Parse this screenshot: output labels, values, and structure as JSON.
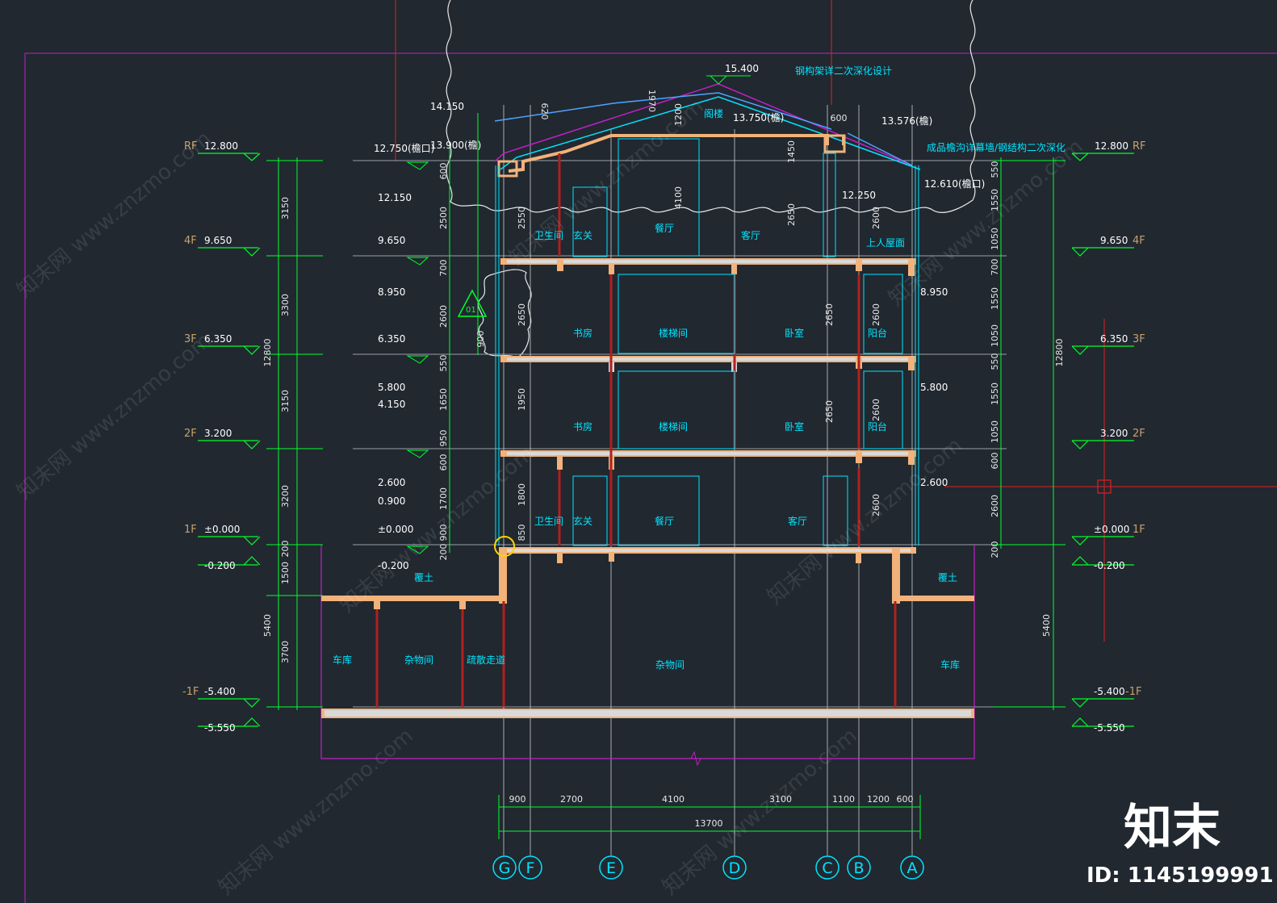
{
  "section": {
    "levels_left": {
      "rf": {
        "tag": "RF",
        "value": "12.800"
      },
      "f4": {
        "tag": "4F",
        "value": "9.650"
      },
      "f3": {
        "tag": "3F",
        "value": "6.350"
      },
      "f2": {
        "tag": "2F",
        "value": "3.200"
      },
      "f1": {
        "tag": "1F",
        "value": "±0.000"
      },
      "f1_sub": "-0.200",
      "b1": {
        "tag": "-1F",
        "value": "-5.400"
      },
      "b1_sub": "-5.550"
    },
    "levels_right": {
      "rf": {
        "tag": "RF",
        "value": "12.800"
      },
      "f4": {
        "tag": "4F",
        "value": "9.650"
      },
      "f3": {
        "tag": "3F",
        "value": "6.350"
      },
      "f2": {
        "tag": "2F",
        "value": "3.200"
      },
      "f1": {
        "tag": "1F",
        "value": "±0.000"
      },
      "f1_sub": "-0.200",
      "b1": {
        "tag": "-1F",
        "value": "-5.400"
      },
      "b1_sub": "-5.550"
    },
    "inner_levels": {
      "ridge": "15.400",
      "l14150": "14.150",
      "l13900": "13.900(檐)",
      "l12750": "12.750(檐口)",
      "l12150": "12.150",
      "l9650": "9.650",
      "l8950": "8.950",
      "l6350": "6.350",
      "l5800": "5.800",
      "l4150": "4.150",
      "l2600": "2.600",
      "l0900": "0.900",
      "l0000": "±0.000",
      "l0200": "-0.200",
      "r13750": "13.750(檐)",
      "r13576": "13.576(檐)",
      "r12250": "12.250",
      "r12610": "12.610(檐口)",
      "r8950": "8.950",
      "r5800": "5.800",
      "r2600": "2.600"
    },
    "left_dims": [
      "3150",
      "3300",
      "3150",
      "3200",
      "200",
      "1500",
      "3700"
    ],
    "left_total": "12800",
    "left_total_b": "5400",
    "inner_left_dims": [
      "600",
      "2500",
      "700",
      "2600",
      "550",
      "1650",
      "950",
      "600",
      "1700",
      "900",
      "200"
    ],
    "right_dims": [
      "550",
      "1550",
      "1050",
      "700",
      "1550",
      "1050",
      "550",
      "1550",
      "1050",
      "600",
      "2600",
      "200"
    ],
    "right_total": "12800",
    "right_total_b": "5400",
    "bottom_dims": [
      "900",
      "2700",
      "4100",
      "3100",
      "1100",
      "1200",
      "600"
    ],
    "bottom_total": "13700",
    "axes": [
      "G",
      "F",
      "E",
      "D",
      "C",
      "B",
      "A"
    ],
    "rooms": {
      "r4_bath": "卫生间",
      "r4_entry": "玄关",
      "r4_dining": "餐厅",
      "r4_living": "客厅",
      "r4_roof": "上人屋面",
      "r3_study": "书房",
      "r3_stair": "楼梯间",
      "r3_bed": "卧室",
      "r3_balc": "阳台",
      "r2_study": "书房",
      "r2_stair": "楼梯间",
      "r2_bed": "卧室",
      "r2_balc": "阳台",
      "r1_bath": "卫生间",
      "r1_entry": "玄关",
      "r1_dining": "餐厅",
      "r1_living": "客厅",
      "attic": "阁楼",
      "soil_l": "覆土",
      "soil_r": "覆土",
      "b_garage_l": "车库",
      "b_store_l": "杂物间",
      "b_corridor": "疏散走道",
      "b_store_c": "杂物间",
      "b_garage_r": "车库"
    },
    "notes": {
      "steel": "钢构架详二次深化设计",
      "curtain": "成品檐沟详幕墙/钢结构二次深化",
      "detail_tag": "01"
    },
    "small_dims": {
      "d620": "620",
      "d1970": "1970",
      "d1200": "1200",
      "d1450": "1450",
      "d600": "600",
      "d4100": "4100",
      "d2650a": "2650",
      "d2650b": "2650",
      "d2650c": "2650",
      "d2650d": "2650",
      "d1950": "1950",
      "d1800": "1800",
      "d850": "850",
      "d900": "900",
      "d2550": "2550",
      "d2600a": "2600",
      "d2600b": "2600",
      "d2600c": "2600",
      "d2600d": "2600"
    }
  },
  "brand": {
    "logo": "知末",
    "id": "ID: 1145199991",
    "watermark": "知末网 www.znzmo.com"
  },
  "colors": {
    "bg": "#212830",
    "dim": "#00ff2a",
    "wall": "#f2b27a",
    "slab": "#d9d9d9",
    "frame": "#c21fc7",
    "cyan": "#00e5ff",
    "red": "#e02020",
    "grid": "#c8ccd2"
  }
}
